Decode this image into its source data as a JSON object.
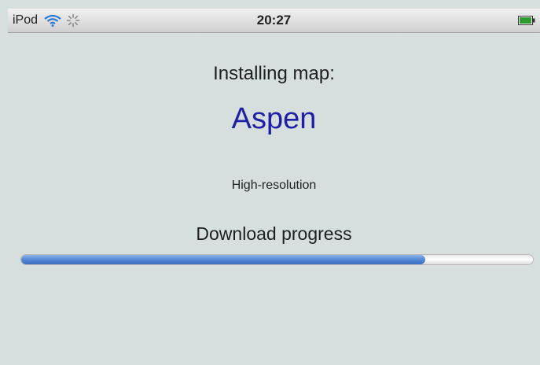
{
  "status_bar": {
    "carrier": "iPod",
    "time": "20:27",
    "icons": [
      "wifi-icon",
      "activity-spinner-icon",
      "battery-icon"
    ]
  },
  "install": {
    "heading": "Installing map:",
    "map_name": "Aspen",
    "resolution": "High-resolution",
    "progress_label": "Download progress",
    "progress_fraction": 0.79
  },
  "colors": {
    "map_name": "#1f1fa6",
    "progress_fill": "#4f86d4",
    "background": "#d6dede"
  }
}
